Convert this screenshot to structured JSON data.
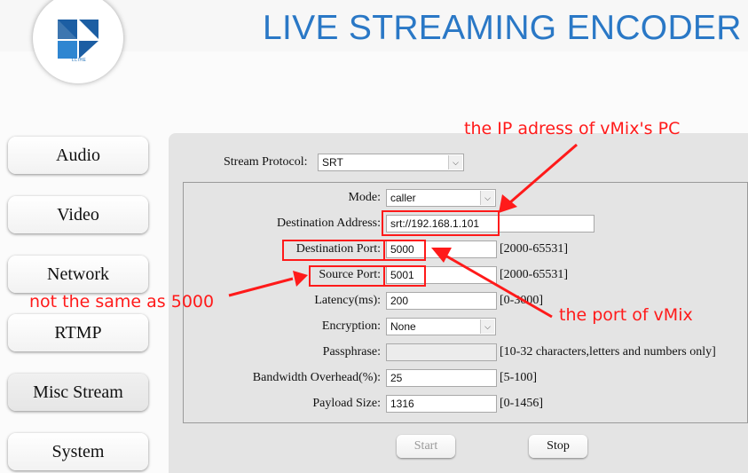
{
  "app": {
    "title": "LIVE STREAMING ENCODER",
    "logo_text": "LLIHE"
  },
  "nav": {
    "items": [
      {
        "label": "Audio"
      },
      {
        "label": "Video"
      },
      {
        "label": "Network"
      },
      {
        "label": "RTMP"
      },
      {
        "label": "Misc Stream"
      },
      {
        "label": "System"
      }
    ]
  },
  "form": {
    "stream_protocol": {
      "label": "Stream Protocol:",
      "value": "SRT"
    },
    "mode": {
      "label": "Mode:",
      "value": "caller"
    },
    "destination_address": {
      "label": "Destination Address:",
      "value": "srt://192.168.1.101"
    },
    "destination_port": {
      "label": "Destination Port:",
      "value": "5000",
      "range": "[2000-65531]"
    },
    "source_port": {
      "label": "Source Port:",
      "value": "5001",
      "range": "[2000-65531]"
    },
    "latency": {
      "label": "Latency(ms):",
      "value": "200",
      "range": "[0-3000]"
    },
    "encryption": {
      "label": "Encryption:",
      "value": "None"
    },
    "passphrase": {
      "label": "Passphrase:",
      "value": "",
      "range": "[10-32 characters,letters and numbers only]"
    },
    "bandwidth_overhead": {
      "label": "Bandwidth Overhead(%):",
      "value": "25",
      "range": "[5-100]"
    },
    "payload_size": {
      "label": "Payload Size:",
      "value": "1316",
      "range": "[0-1456]"
    }
  },
  "actions": {
    "start_label": "Start",
    "stop_label": "Stop"
  },
  "annotations": {
    "ip_note": "the IP adress of vMix's PC",
    "port_note": "the port of vMix",
    "source_note": "not the same as 5000"
  },
  "colors": {
    "title": "#2a78c6",
    "annotation": "#ff1a1a",
    "panel": "#e4e4e4"
  }
}
